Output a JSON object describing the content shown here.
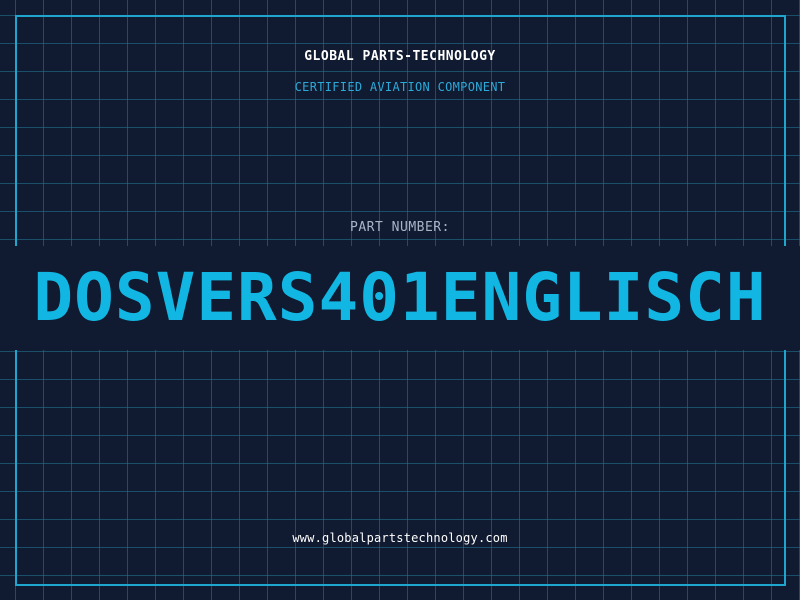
{
  "header": {
    "company": "GLOBAL PARTS-TECHNOLOGY",
    "tagline": "CERTIFIED AVIATION COMPONENT"
  },
  "part": {
    "label": "PART NUMBER:",
    "number": "DOSVERS401ENGLISCH"
  },
  "footer": {
    "website": "www.globalpartstechnology.com"
  },
  "colors": {
    "background": "#101a30",
    "grid": "#24788f",
    "frame": "#1fa6cf",
    "accent": "#12b6e3",
    "label": "#aab4c8",
    "text": "#ffffff"
  }
}
